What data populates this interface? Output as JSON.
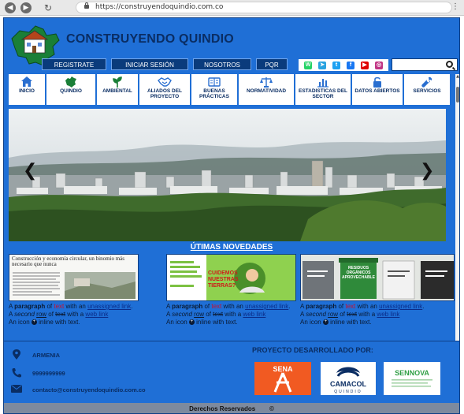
{
  "browser": {
    "url": "https://construyendoquindio.com.co",
    "back_label": "◀",
    "forward_label": "▶",
    "reload_label": "↻",
    "menu_label": "⋮"
  },
  "site": {
    "title": "CONSTRUYENDO QUINDIO",
    "top_nav": [
      "REGISTRATE",
      "INICIAR SESIÓN",
      "NOSOTROS",
      "PQR"
    ],
    "social": [
      {
        "name": "whatsapp-icon",
        "color": "#25d366",
        "glyph": "W"
      },
      {
        "name": "telegram-icon",
        "color": "#2aa3e0",
        "glyph": "➤"
      },
      {
        "name": "twitter-icon",
        "color": "#1da1f2",
        "glyph": "t"
      },
      {
        "name": "facebook-icon",
        "color": "#1877f2",
        "glyph": "f"
      },
      {
        "name": "youtube-icon",
        "color": "#e00000",
        "glyph": "▶"
      },
      {
        "name": "instagram-icon",
        "color": "#c13584",
        "glyph": "◎"
      }
    ],
    "menu": [
      {
        "label": "INICIO",
        "icon": "home-icon"
      },
      {
        "label": "QUINDIO",
        "icon": "map-icon"
      },
      {
        "label": "AMBIENTAL",
        "icon": "plant-icon"
      },
      {
        "label": "ALIADOS DEL PROYECTO",
        "icon": "handshake-icon"
      },
      {
        "label": "BUENAS PRÁCTICAS",
        "icon": "book-icon"
      },
      {
        "label": "NORMATIVIDAD",
        "icon": "scale-icon"
      },
      {
        "label": "ESTADISTICAS DEL SECTOR",
        "icon": "chart-icon"
      },
      {
        "label": "DATOS ABIERTOS",
        "icon": "lock-icon"
      },
      {
        "label": "SERVICIOS",
        "icon": "wrench-icon"
      }
    ],
    "hero_prev": "❮",
    "hero_next": "❯",
    "news_title": "ÚTIMAS NOVEDADES",
    "cards": [
      {
        "image_headline": "Construcción y economía circular, un binomio más necesario que nunca"
      },
      {
        "image_headline": "CUIDEMOS NUESTRAS TIERRAS?"
      },
      {
        "image_headline": "RESIDUOS ORGÁNICOS APROVECHABLES"
      }
    ],
    "card_text": {
      "p1": "A ",
      "p1_bold": "paragraph",
      "p1_of": " of ",
      "p1_red": "text",
      "p1_with": " with an ",
      "p1_link": "unassigned link",
      "p1_end": ".",
      "p2_a": "A ",
      "p2_italic": "second",
      "p2_b": " ",
      "p2_row": "row",
      "p2_c": " of ",
      "p2_strike": "text",
      "p2_d": " with a ",
      "p2_link": "web link",
      "p3_a": "An icon ",
      "p3_icon": "+",
      "p3_b": " inline with text."
    },
    "footer": {
      "city": "ARMENIA",
      "phone": "9999999999",
      "email": "contacto@construyendoquindio.com.co",
      "partners_title": "PROYECTO DESARROLLADO POR:",
      "partners": [
        {
          "name": "SENA"
        },
        {
          "name": "CAMACOL",
          "sub": "QUINDIO"
        },
        {
          "name": "SENNOVA"
        }
      ],
      "copyright": "Derechos Reservados",
      "copyright_symbol": "©"
    }
  }
}
